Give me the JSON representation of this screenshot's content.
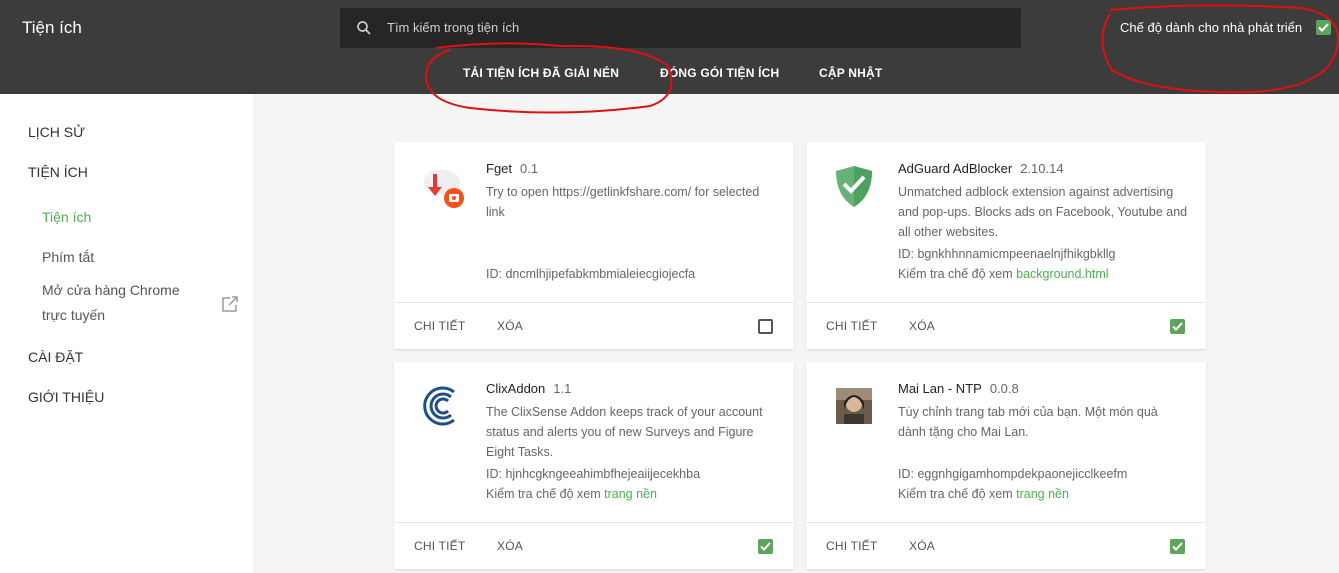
{
  "header": {
    "title": "Tiện ích",
    "search_placeholder": "Tìm kiếm trong tiện ích",
    "dev_mode_label": "Chế độ dành cho nhà phát triển",
    "dev_mode_on": true,
    "toolbar": {
      "load_unpacked": "TẢI TIỆN ÍCH ĐÃ GIẢI NÉN",
      "pack": "ĐÓNG GÓI TIỆN ÍCH",
      "update": "CẬP NHẬT"
    }
  },
  "sidebar": {
    "history": "LỊCH SỬ",
    "extensions": "TIỆN ÍCH",
    "sub_extensions": "Tiện ích",
    "sub_shortcuts": "Phím tắt",
    "store_line1": "Mở cửa hàng Chrome",
    "store_line2": "trực tuyến",
    "settings": "CÀI ĐẶT",
    "about": "GIỚI THIỆU"
  },
  "cards": [
    {
      "name": "Fget",
      "version": "0.1",
      "description": "Try to open https://getlinkfshare.com/ for selected link",
      "id": "ID: dncmlhjipefabkmbmialeiecgiojecfa",
      "inspect_label": "",
      "inspect_link": "",
      "enabled": false,
      "icon": "cloud-download-icon"
    },
    {
      "name": "AdGuard AdBlocker",
      "version": "2.10.14",
      "description": "Unmatched adblock extension against advertising and pop-ups. Blocks ads on Facebook, Youtube and all other websites.",
      "id": "ID: bgnkhhnnamicmpeenaelnjfhikgbkllg",
      "inspect_label": "Kiểm tra chế độ xem",
      "inspect_link": "background.html",
      "enabled": true,
      "icon": "shield-check-icon"
    },
    {
      "name": "ClixAddon",
      "version": "1.1",
      "description": "The ClixSense Addon keeps track of your account status and alerts you of new Surveys and Figure Eight Tasks.",
      "id": "ID: hjnhcgkngeeahimbfhejeaiijecekhba",
      "inspect_label": "Kiểm tra chế độ xem",
      "inspect_link": "trang nền",
      "enabled": true,
      "icon": "clixsense-logo-icon"
    },
    {
      "name": "Mai Lan - NTP",
      "version": "0.0.8",
      "description": "Tùy chỉnh trang tab mới của bạn. Một món quà dành tặng cho Mai Lan.",
      "id": "ID: eggnhgigamhompdekpaonejicclkeefm",
      "inspect_label": "Kiểm tra chế độ xem",
      "inspect_link": "trang nền",
      "enabled": true,
      "icon": "portrait-photo-icon"
    }
  ],
  "card_buttons": {
    "details": "CHI TIẾT",
    "remove": "XÓA"
  },
  "colors": {
    "accent": "#4caf50",
    "header_bg": "#3c3c3c",
    "annotation": "#e01010"
  }
}
